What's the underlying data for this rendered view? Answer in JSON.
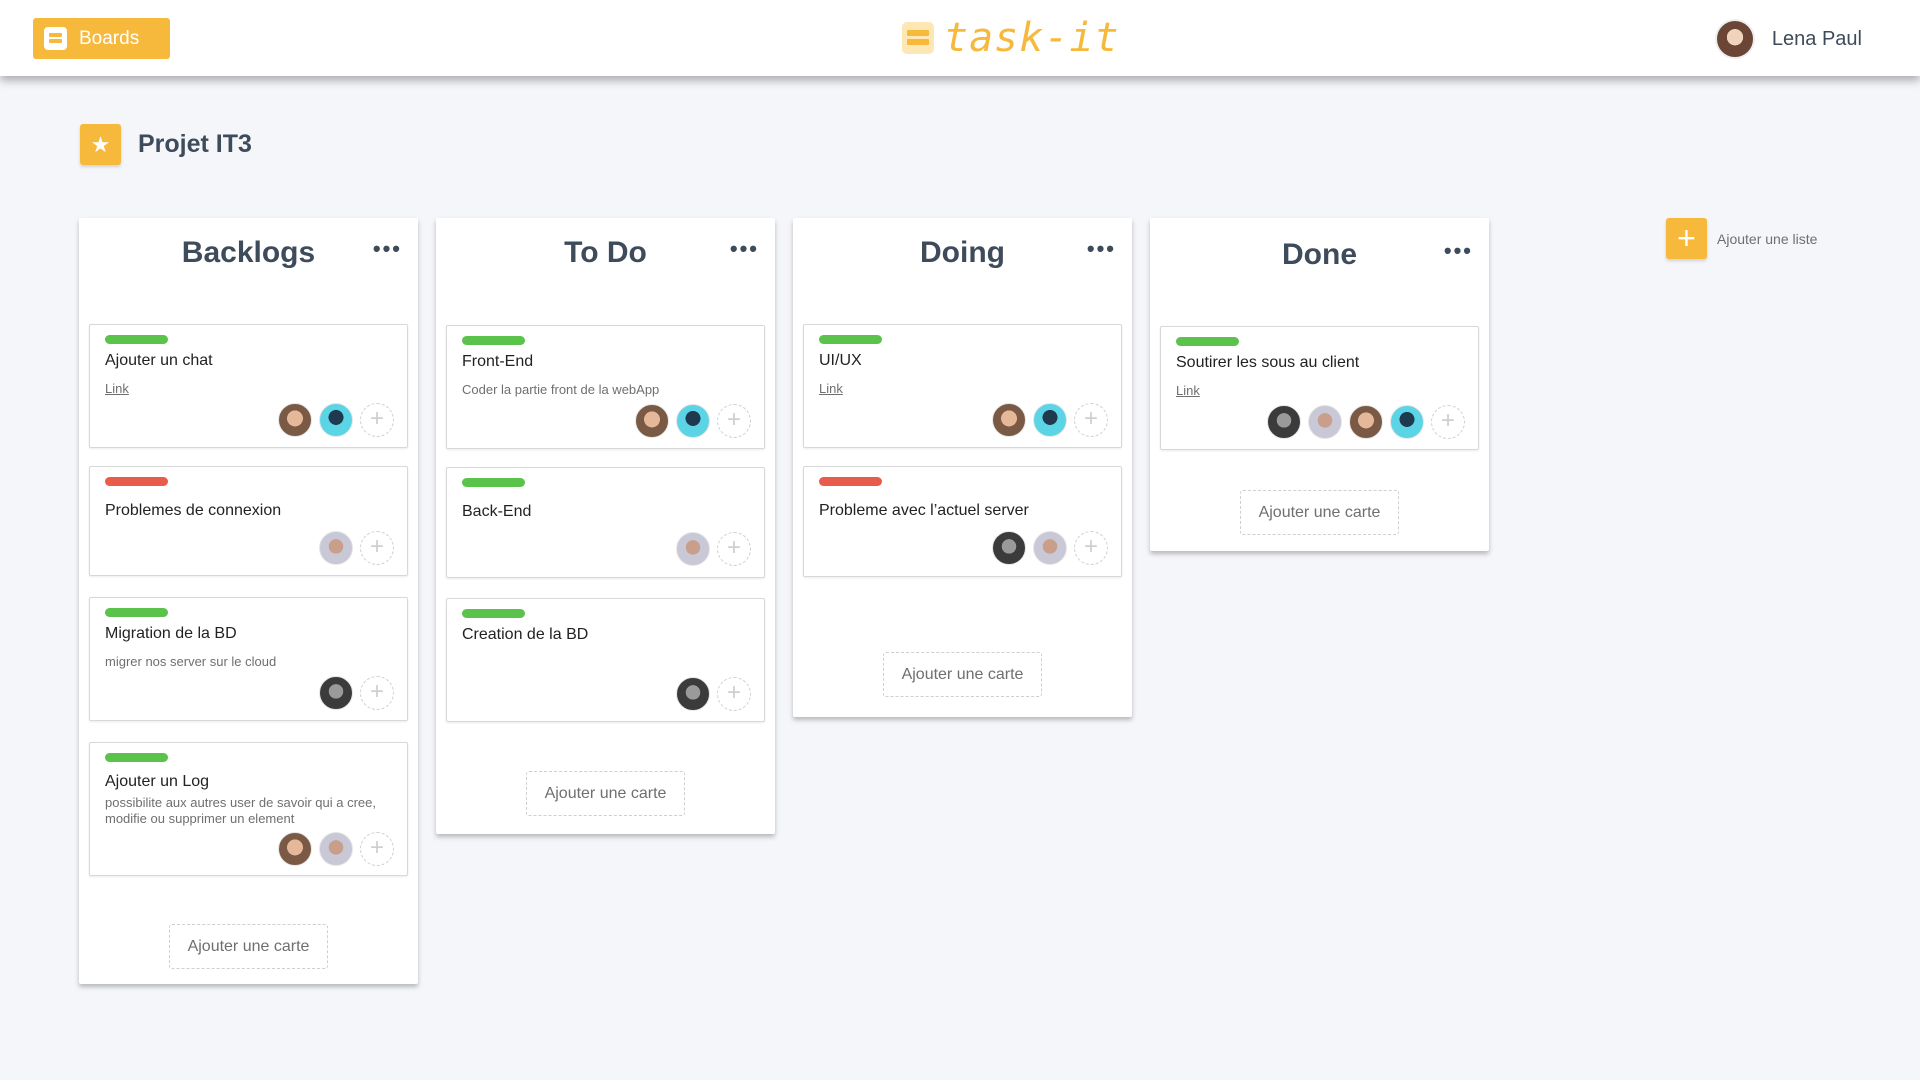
{
  "header": {
    "boards_label": "Boards",
    "logo_text": "task-it",
    "user_name": "Lena Paul"
  },
  "project": {
    "title": "Projet IT3"
  },
  "colors": {
    "accent": "#f6b93b",
    "label_green": "#5bc24c",
    "label_red": "#e95c4b"
  },
  "add_list_label": "Ajouter une liste",
  "add_card_label": "Ajouter une carte",
  "lists": [
    {
      "title": "Backlogs",
      "menu": "•••",
      "cards": [
        {
          "title": "Ajouter un chat",
          "link": "Link",
          "label": "green"
        },
        {
          "title": "Problemes de connexion",
          "label": "red"
        },
        {
          "title": "Migration de la BD",
          "desc": "migrer nos server sur le cloud",
          "label": "green"
        },
        {
          "title": "Ajouter un Log",
          "desc": "possibilite aux autres user de savoir qui a cree, modifie ou supprimer un element",
          "label": "green"
        }
      ]
    },
    {
      "title": "To Do",
      "menu": "•••",
      "cards": [
        {
          "title": "Front-End",
          "desc": "Coder la partie front de la webApp",
          "label": "green"
        },
        {
          "title": "Back-End",
          "label": "green"
        },
        {
          "title": "Creation de la BD",
          "label": "green"
        }
      ]
    },
    {
      "title": "Doing",
      "menu": "•••",
      "cards": [
        {
          "title": "UI/UX",
          "link": "Link",
          "label": "green"
        },
        {
          "title": "Probleme avec l’actuel server",
          "label": "red"
        }
      ]
    },
    {
      "title": "Done",
      "menu": "•••",
      "cards": [
        {
          "title": "Soutirer les sous au client",
          "link": "Link",
          "label": "green"
        }
      ]
    }
  ]
}
